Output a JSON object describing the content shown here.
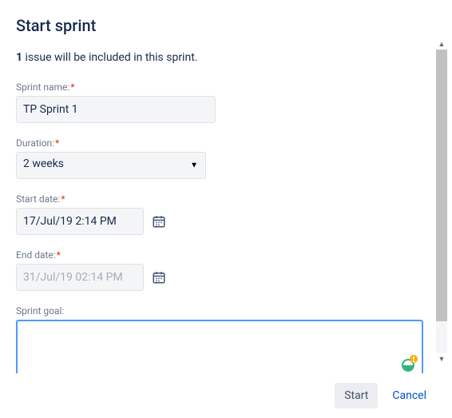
{
  "dialog": {
    "title": "Start sprint",
    "issue_count": "1",
    "issue_suffix": " issue will be included in this sprint."
  },
  "fields": {
    "sprint_name": {
      "label": "Sprint name:",
      "value": "TP Sprint 1"
    },
    "duration": {
      "label": "Duration:",
      "value": "2 weeks"
    },
    "start_date": {
      "label": "Start date:",
      "value": "17/Jul/19 2:14 PM"
    },
    "end_date": {
      "label": "End date:",
      "value": "31/Jul/19 02:14 PM"
    },
    "sprint_goal": {
      "label": "Sprint goal:",
      "value": ""
    }
  },
  "buttons": {
    "start": "Start",
    "cancel": "Cancel"
  }
}
